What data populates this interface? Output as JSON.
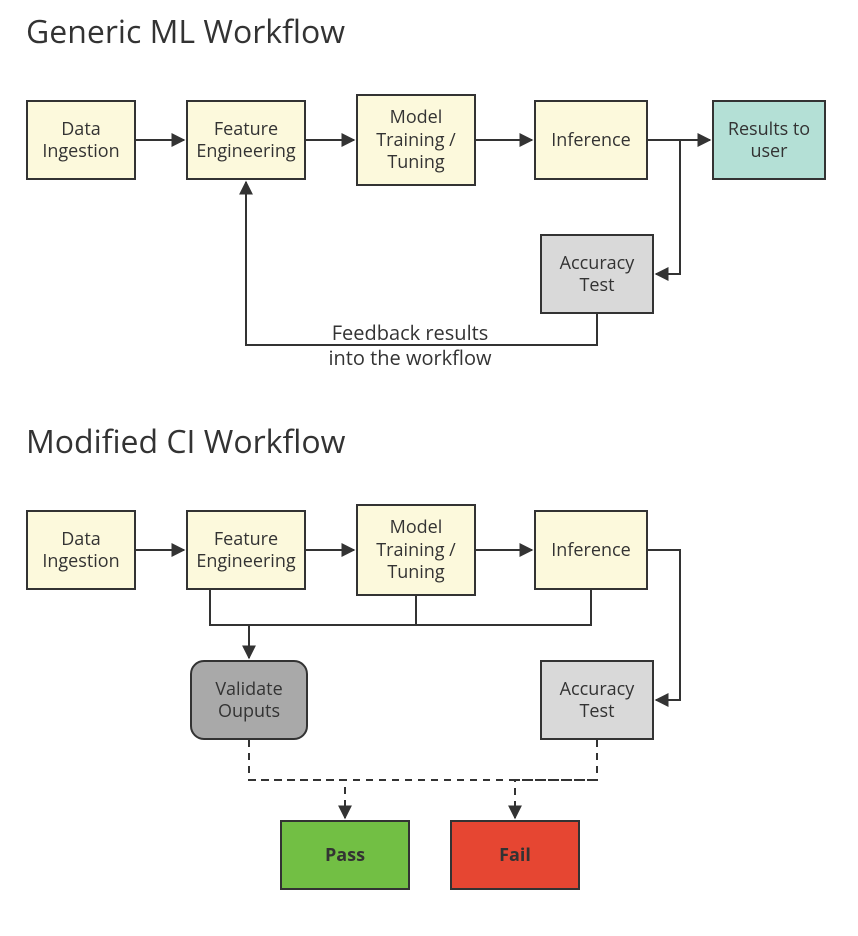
{
  "section1": {
    "title": "Generic ML Workflow",
    "boxes": {
      "data_ingestion": "Data\nIngestion",
      "feature_engineering": "Feature\nEngineering",
      "model_training": "Model\nTraining /\nTuning",
      "inference": "Inference",
      "results_to_user": "Results to\nuser",
      "accuracy_test": "Accuracy\nTest"
    },
    "feedback_label": "Feedback results\ninto the workflow"
  },
  "section2": {
    "title": "Modified CI Workflow",
    "boxes": {
      "data_ingestion": "Data\nIngestion",
      "feature_engineering": "Feature\nEngineering",
      "model_training": "Model\nTraining /\nTuning",
      "inference": "Inference",
      "validate_outputs": "Validate\nOuputs",
      "accuracy_test": "Accuracy\nTest",
      "pass": "Pass",
      "fail": "Fail"
    }
  }
}
